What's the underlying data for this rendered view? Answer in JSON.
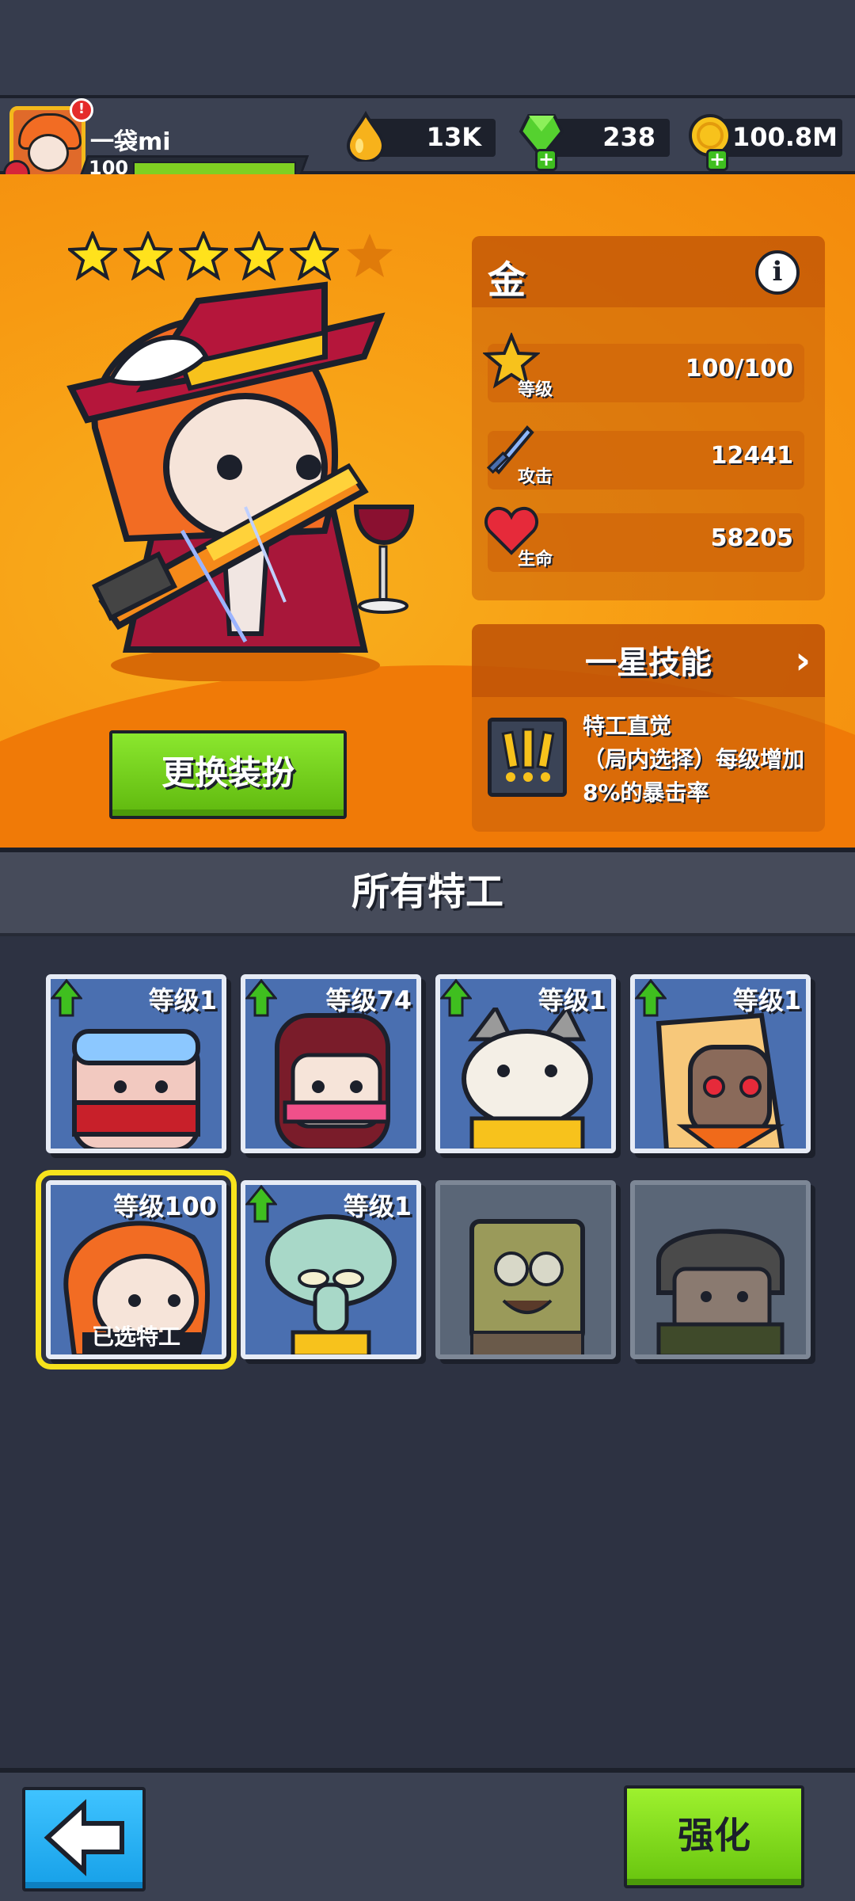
{
  "player": {
    "name": "一袋mi",
    "level": "100",
    "alert": "!"
  },
  "resources": [
    {
      "name": "energy",
      "icon": "drop-icon",
      "value": "13K"
    },
    {
      "name": "gems",
      "icon": "gem-icon",
      "value": "238"
    },
    {
      "name": "coins",
      "icon": "coin-icon",
      "value": "100.8M"
    }
  ],
  "hero": {
    "stars_filled": 5,
    "stars_total": 6,
    "change_outfit_label": "更换装扮",
    "rarity": "金",
    "stats": [
      {
        "label": "等级",
        "value": "100/100",
        "icon": "level-star-icon"
      },
      {
        "label": "攻击",
        "value": "12441",
        "icon": "sword-icon"
      },
      {
        "label": "生命",
        "value": "58205",
        "icon": "heart-icon"
      }
    ],
    "skill_header": "一星技能",
    "skill_name": "特工直觉",
    "skill_desc": "（局内选择）每级增加8%的暴击率"
  },
  "section_title": "所有特工",
  "agents": [
    {
      "level": "等级1",
      "upgradable": true,
      "locked": false,
      "selected": false,
      "art": "goggle-agent"
    },
    {
      "level": "等级74",
      "upgradable": true,
      "locked": false,
      "selected": false,
      "art": "ninja-girl"
    },
    {
      "level": "等级1",
      "upgradable": true,
      "locked": false,
      "selected": false,
      "art": "cat"
    },
    {
      "level": "等级1",
      "upgradable": true,
      "locked": false,
      "selected": false,
      "art": "gasmask"
    },
    {
      "level": "等级100",
      "upgradable": false,
      "locked": false,
      "selected": true,
      "selected_label": "已选特工",
      "art": "red-hair"
    },
    {
      "level": "等级1",
      "upgradable": true,
      "locked": false,
      "selected": false,
      "art": "squid"
    },
    {
      "level": "",
      "upgradable": false,
      "locked": true,
      "selected": false,
      "art": "sponge"
    },
    {
      "level": "",
      "upgradable": false,
      "locked": true,
      "selected": false,
      "art": "soldier"
    }
  ],
  "bottom": {
    "upgrade_label": "强化"
  },
  "colors": {
    "gold": "#f7c21c",
    "green": "#7fd022",
    "orange": "#f79a12",
    "blue": "#16a0e8"
  }
}
